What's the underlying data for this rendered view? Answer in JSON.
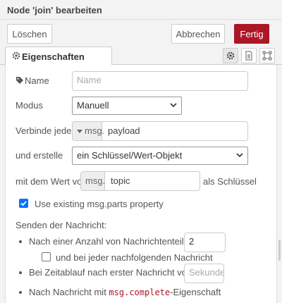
{
  "dialog": {
    "title": "Node 'join' bearbeiten",
    "delete_label": "Löschen",
    "cancel_label": "Abbrechen",
    "done_label": "Fertig"
  },
  "tabs": {
    "properties_label": "Eigenschaften",
    "icons": [
      "gear-icon",
      "description-icon",
      "appearance-icon"
    ]
  },
  "form": {
    "name_label": "Name",
    "name_placeholder": "Name",
    "mode_label": "Modus",
    "mode_value": "Manuell",
    "combine_label": "Verbinde jede",
    "combine_type": "msg.",
    "combine_value": "payload",
    "create_label": "und erstelle",
    "create_value": "ein Schlüssel/Wert-Objekt",
    "key_prefix_label": "mit dem Wert von",
    "key_type": "msg.",
    "key_value": "topic",
    "key_suffix_label": "als Schlüssel",
    "use_parts_label": "Use existing msg.parts property",
    "use_parts_checked": true,
    "send_heading": "Senden der Nachricht:",
    "count_label": "Nach einer Anzahl von Nachrichtenteilen",
    "count_value": "2",
    "every_subsequent_label": "und bei jeder nachfolgenden Nachricht",
    "every_subsequent_checked": false,
    "timeout_label": "Bei Zeitablauf nach erster Nachricht von",
    "timeout_placeholder": "Sekunden",
    "complete_prefix": "Nach Nachricht mit ",
    "complete_code": "msg.complete",
    "complete_suffix": "-Eigenschaft"
  },
  "colors": {
    "accent": "#ad1625",
    "checkbox": "#0075ff"
  }
}
